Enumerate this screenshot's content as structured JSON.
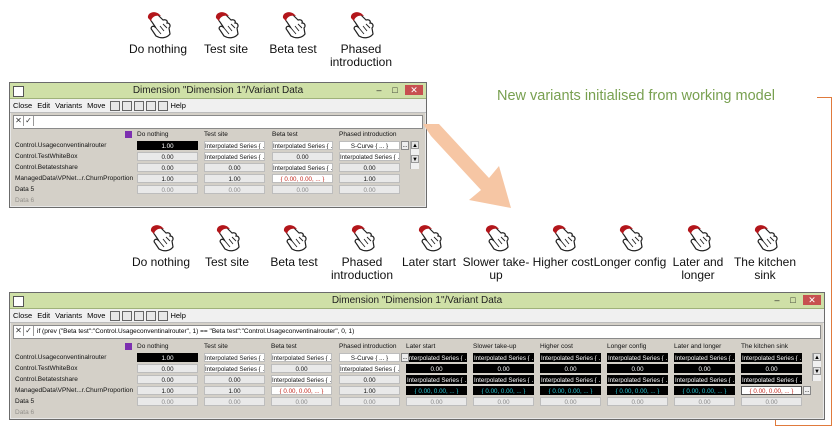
{
  "top_variants": [
    "Do nothing",
    "Test site",
    "Beta test",
    "Phased introduction"
  ],
  "mid_variants": [
    "Do nothing",
    "Test site",
    "Beta test",
    "Phased introduction",
    "Later start",
    "Slower take-up",
    "Higher cost",
    "Longer config",
    "Later and longer",
    "The kitchen sink"
  ],
  "icon": "hand-pointer-icon",
  "annotation": "New variants initialised from working model",
  "colors": {
    "annotation": "#78a050",
    "bracket": "#e07a3c",
    "arrow": "#f6c6a4",
    "titlebar": "#cfe0a7",
    "expand_marker": "#7c2fb0",
    "cyan_values": "#29c7d4",
    "red_values": "#c0281e"
  },
  "window1": {
    "title": "Dimension \"Dimension 1\"/Variant Data",
    "menu": [
      "Close",
      "Edit",
      "Variants",
      "Move"
    ],
    "menu_help": "Help",
    "formula": "",
    "columns": [
      "Do nothing",
      "Test site",
      "Beta test",
      "Phased introduction"
    ],
    "rows": [
      {
        "label": "Control.Usageconventinalrouter",
        "cells": [
          "1.00",
          "Interpolated Series { ... }",
          "Interpolated Series { ... }",
          "S-Curve { ... }"
        ]
      },
      {
        "label": "Control.TestWhiteBox",
        "cells": [
          "0.00",
          "Interpolated Series { ... }",
          "0.00",
          "Interpolated Series { ... }"
        ]
      },
      {
        "label": "Control.Betatestshare",
        "cells": [
          "0.00",
          "0.00",
          "Interpolated Series { ... }",
          "0.00"
        ]
      },
      {
        "label": "ManagedData\\VPNet...r.ChurnProportion",
        "cells": [
          "1.00",
          "1.00",
          "{ 0.00, 0.00, ... }",
          "1.00"
        ]
      },
      {
        "label": "Data 5",
        "cells": [
          "0.00",
          "0.00",
          "0.00",
          "0.00"
        ]
      },
      {
        "label": "Data 6",
        "cells": [
          "",
          "",
          "",
          ""
        ]
      }
    ]
  },
  "window2": {
    "title": "Dimension \"Dimension 1\"/Variant Data",
    "menu": [
      "Close",
      "Edit",
      "Variants",
      "Move"
    ],
    "menu_help": "Help",
    "formula": "if (prev (\"Beta test\":\"Control.Usageconventinalrouter\", 1) == \"Beta test\":\"Control.Usageconventinalrouter\", 0, 1)",
    "columns": [
      "Do nothing",
      "Test site",
      "Beta test",
      "Phased introduction",
      "Later start",
      "Slower take-up",
      "Higher cost",
      "Longer config",
      "Later and longer",
      "The kitchen sink"
    ],
    "rows": [
      {
        "label": "Control.Usageconventinalrouter",
        "cells": [
          "1.00",
          "Interpolated Series { ... }",
          "Interpolated Series { ... }",
          "S-Curve { ... }",
          "Interpolated Series { ... }",
          "Interpolated Series { ... }",
          "Interpolated Series { ... }",
          "Interpolated Series { ... }",
          "Interpolated Series { ... }",
          "Interpolated Series { ... }"
        ]
      },
      {
        "label": "Control.TestWhiteBox",
        "cells": [
          "0.00",
          "Interpolated Series { ... }",
          "0.00",
          "Interpolated Series { ... }",
          "0.00",
          "0.00",
          "0.00",
          "0.00",
          "0.00",
          "0.00"
        ]
      },
      {
        "label": "Control.Betatestshare",
        "cells": [
          "0.00",
          "0.00",
          "Interpolated Series { ... }",
          "0.00",
          "Interpolated Series { ... }",
          "Interpolated Series { ... }",
          "Interpolated Series { ... }",
          "Interpolated Series { ... }",
          "Interpolated Series { ... }",
          "Interpolated Series { ... }"
        ]
      },
      {
        "label": "ManagedData\\VPNet...r.ChurnProportion",
        "cells": [
          "1.00",
          "1.00",
          "{ 0.00, 0.00, ... }",
          "1.00",
          "{ 0.00, 0.00, ... }",
          "{ 0.00, 0.00, ... }",
          "{ 0.00, 0.00, ... }",
          "{ 0.00, 0.00, ... }",
          "{ 0.00, 0.00, ... }",
          "{ 0.00, 0.00, ... }"
        ]
      },
      {
        "label": "Data 5",
        "cells": [
          "0.00",
          "0.00",
          "0.00",
          "0.00",
          "0.00",
          "0.00",
          "0.00",
          "0.00",
          "0.00",
          "0.00"
        ]
      },
      {
        "label": "Data 6",
        "cells": [
          "",
          "",
          "",
          "",
          "",
          "",
          "",
          "",
          "",
          ""
        ]
      }
    ]
  }
}
